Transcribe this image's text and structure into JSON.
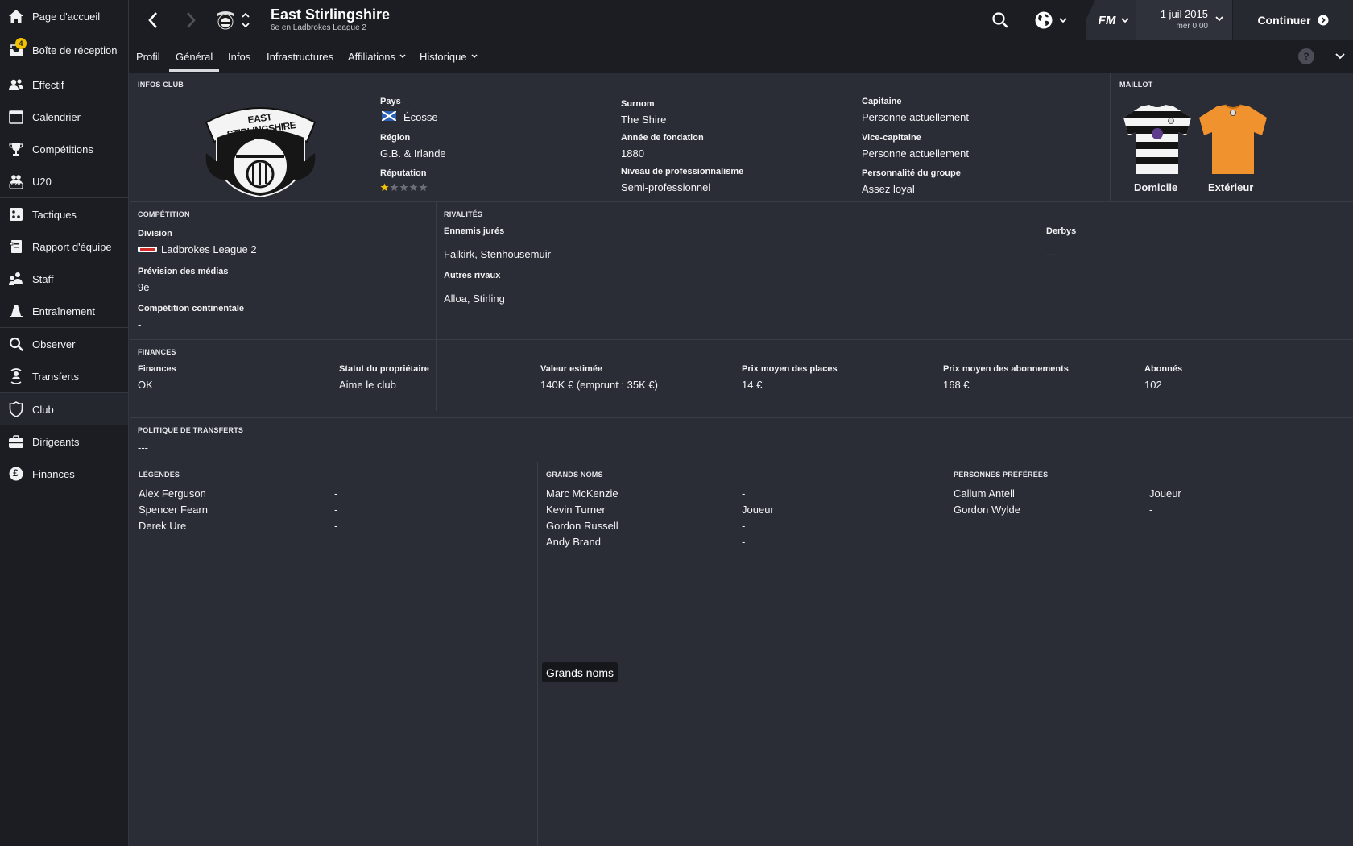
{
  "sidebar": {
    "items": [
      {
        "label": "Page d'accueil",
        "icon": "home-icon"
      },
      {
        "label": "Boîte de réception",
        "icon": "inbox-icon",
        "badge": "4"
      },
      {
        "label": "Effectif",
        "icon": "squad-icon"
      },
      {
        "label": "Calendrier",
        "icon": "calendar-icon"
      },
      {
        "label": "Compétitions",
        "icon": "trophy-icon"
      },
      {
        "label": "U20",
        "icon": "u20-icon",
        "icon_text": "U20"
      },
      {
        "label": "Tactiques",
        "icon": "tactics-icon"
      },
      {
        "label": "Rapport d'équipe",
        "icon": "report-icon"
      },
      {
        "label": "Staff",
        "icon": "staff-icon"
      },
      {
        "label": "Entraînement",
        "icon": "training-cone-icon"
      },
      {
        "label": "Observer",
        "icon": "scout-search-icon"
      },
      {
        "label": "Transferts",
        "icon": "transfers-icon"
      },
      {
        "label": "Club",
        "icon": "club-shield-icon"
      },
      {
        "label": "Dirigeants",
        "icon": "briefcase-icon"
      },
      {
        "label": "Finances",
        "icon": "pound-icon",
        "icon_text": "£"
      }
    ]
  },
  "header": {
    "title": "East Stirlingshire",
    "subtitle": "6e en Ladbrokes League 2",
    "fm_label": "FM",
    "date": "1 juil 2015",
    "time": "mer 0:00",
    "continue_label": "Continuer"
  },
  "tabs": [
    {
      "label": "Profil"
    },
    {
      "label": "Général",
      "active": true
    },
    {
      "label": "Infos"
    },
    {
      "label": "Infrastructures"
    },
    {
      "label": "Affiliations",
      "dropdown": true
    },
    {
      "label": "Historique",
      "dropdown": true
    }
  ],
  "help_label": "?",
  "club_info": {
    "section_title": "INFOS CLUB",
    "crest_text_top": "EAST STIRLINGSHIRE",
    "crest_text_mid": "F.C.",
    "pays_label": "Pays",
    "pays_value": "Écosse",
    "region_label": "Région",
    "region_value": "G.B. & Irlande",
    "reputation_label": "Réputation",
    "reputation_stars": 1,
    "reputation_max": 5,
    "surnom_label": "Surnom",
    "surnom_value": "The Shire",
    "fondation_label": "Année de fondation",
    "fondation_value": "1880",
    "pro_label": "Niveau de professionnalisme",
    "pro_value": "Semi-professionnel",
    "capitaine_label": "Capitaine",
    "capitaine_value": "Personne actuellement",
    "vice_label": "Vice-capitaine",
    "vice_value": "Personne actuellement",
    "perso_label": "Personnalité du groupe",
    "perso_value": "Assez loyal"
  },
  "kit": {
    "section_title": "MAILLOT",
    "home_label": "Domicile",
    "away_label": "Extérieur",
    "home_color_a": "#ffffff",
    "home_color_b": "#111111",
    "away_color": "#f0922e"
  },
  "competition": {
    "section_title": "COMPÉTITION",
    "division_label": "Division",
    "division_value": "Ladbrokes League 2",
    "prevision_label": "Prévision des médias",
    "prevision_value": "9e",
    "continental_label": "Compétition continentale",
    "continental_value": "-"
  },
  "rivalries": {
    "section_title": "RIVALITÉS",
    "ennemis_label": "Ennemis jurés",
    "ennemis_value": "Falkirk, Stenhousemuir",
    "autres_label": "Autres rivaux",
    "autres_value": "Alloa, Stirling",
    "derbys_label": "Derbys",
    "derbys_value": "---"
  },
  "finances": {
    "section_title": "FINANCES",
    "columns": [
      {
        "label": "Finances",
        "value": "OK"
      },
      {
        "label": "Statut du propriétaire",
        "value": "Aime le club"
      },
      {
        "label": "Valeur estimée",
        "value": "140K € (emprunt : 35K €)"
      },
      {
        "label": "Prix moyen des places",
        "value": "14 €"
      },
      {
        "label": "Prix moyen des abonnements",
        "value": "168 €"
      },
      {
        "label": "Abonnés",
        "value": "102"
      }
    ]
  },
  "transfer_policy": {
    "section_title": "POLITIQUE DE TRANSFERTS",
    "value": "---"
  },
  "legends": {
    "section_title": "LÉGENDES",
    "rows": [
      {
        "name": "Alex Ferguson",
        "role": "-"
      },
      {
        "name": "Spencer Fearn",
        "role": "-"
      },
      {
        "name": "Derek Ure",
        "role": "-"
      }
    ]
  },
  "big_names": {
    "section_title": "GRANDS NOMS",
    "rows": [
      {
        "name": "Marc McKenzie",
        "role": "-"
      },
      {
        "name": "Kevin Turner",
        "role": "Joueur"
      },
      {
        "name": "Gordon Russell",
        "role": "-"
      },
      {
        "name": "Andy Brand",
        "role": "-"
      }
    ]
  },
  "favoured": {
    "section_title": "PERSONNES PRÉFÉRÉES",
    "rows": [
      {
        "name": "Callum Antell",
        "role": "Joueur"
      },
      {
        "name": "Gordon Wylde",
        "role": "-"
      }
    ]
  },
  "tooltip": "Grands noms",
  "colors": {
    "sidebar_bg": "#1b1d23",
    "panel_bg": "#2a2d36",
    "badge": "#f2c200",
    "star_on": "#f2c200",
    "star_off": "#6c6f77"
  }
}
